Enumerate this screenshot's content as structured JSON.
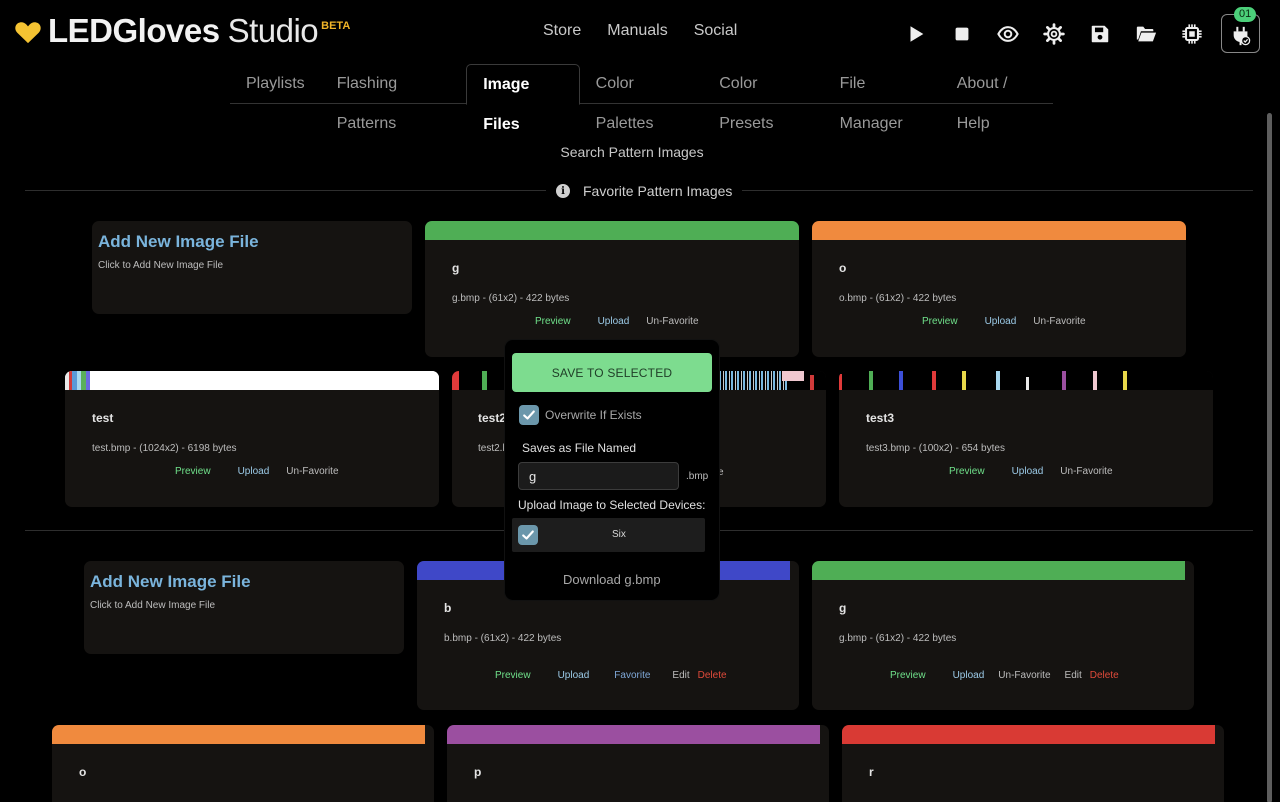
{
  "app": {
    "logo_text": "LEDGloves",
    "logo_studio": "Studio",
    "logo_beta": "BETA",
    "brand_color": "#f5c332"
  },
  "topnav": [
    "Store",
    "Manuals",
    "Social"
  ],
  "toolbar": {
    "icons": [
      "play-icon",
      "stop-icon",
      "eye-icon",
      "gear-icon",
      "save-icon",
      "folder-open-icon",
      "chip-icon",
      "device-plug-icon"
    ],
    "device_count": "01"
  },
  "tabs": [
    "Playlists",
    "Flashing Patterns",
    "Image Files",
    "Color Palettes",
    "Color Presets",
    "File Manager",
    "About / Help"
  ],
  "active_tab": "Image Files",
  "search_label": "Search Pattern Images",
  "favorites_title": "Favorite Pattern Images",
  "add_card": {
    "title": "Add New Image File",
    "subtitle": "Click to Add New Image File"
  },
  "actions": {
    "preview": "Preview",
    "upload": "Upload",
    "unfavorite": "Un-Favorite",
    "favorite": "Favorite",
    "edit": "Edit",
    "delete": "Delete"
  },
  "favorites": [
    {
      "name": "g",
      "info": "g.bmp - (61x2) - 422 bytes",
      "color": "#4fae55"
    },
    {
      "name": "o",
      "info": "o.bmp - (61x2) - 422 bytes",
      "color": "#f08a3e"
    },
    {
      "name": "test",
      "info": "test.bmp - (1024x2) - 6198 bytes"
    },
    {
      "name": "test2",
      "info": "test2.b",
      "info_tail": "e"
    },
    {
      "name": "test3",
      "info": "test3.bmp - (100x2) - 654 bytes"
    }
  ],
  "images": [
    {
      "name": "b",
      "info": "b.bmp - (61x2) - 422 bytes",
      "color": "#3f48c8"
    },
    {
      "name": "g",
      "info": "g.bmp - (61x2) - 422 bytes",
      "color": "#4fae55"
    },
    {
      "name": "o",
      "color": "#f08a3e"
    },
    {
      "name": "p",
      "color": "#9b4fa0"
    },
    {
      "name": "r",
      "color": "#d93a34"
    }
  ],
  "popup": {
    "save_label": "SAVE TO SELECTED",
    "overwrite_label": "Overwrite If Exists",
    "overwrite_checked": true,
    "saves_as_label": "Saves as File Named",
    "filename_value": "g",
    "extension": ".bmp",
    "upload_to_label": "Upload Image to Selected Devices:",
    "device_name": "Six",
    "device_checked": true,
    "download_label": "Download g.bmp"
  }
}
